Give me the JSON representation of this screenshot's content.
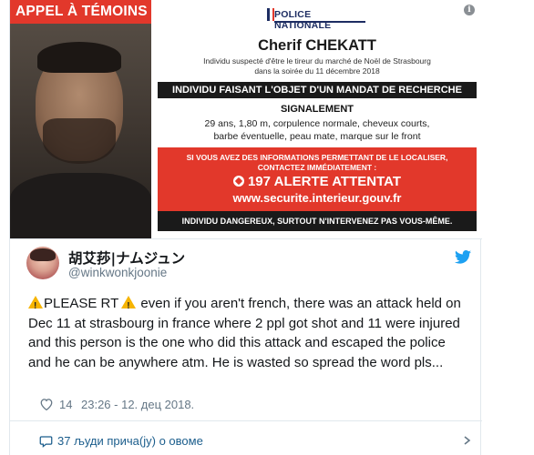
{
  "poster": {
    "appel": "APPEL À TÉMOINS",
    "logo_text": "POLICE NATIONALE",
    "info_symbol": "i",
    "name": "Cherif CHEKATT",
    "sub_line1": "Individu suspecté d'être le tireur du marché de Noël de Strasbourg",
    "sub_line2": "dans la soirée du 11 décembre 2018",
    "mandat": "INDIVIDU FAISANT L'OBJET D'UN MANDAT DE RECHERCHE",
    "signalement_title": "SIGNALEMENT",
    "signalement_line1": "29 ans, 1,80 m, corpulence normale, cheveux courts,",
    "signalement_line2": "barbe éventuelle, peau mate, marque sur le front",
    "red_line1": "SI VOUS AVEZ DES INFORMATIONS PERMETTANT DE LE LOCALISER,",
    "red_line2": "CONTACTEZ IMMÉDIATEMENT :",
    "alert": "197 ALERTE ATTENTAT",
    "website": "www.securite.interieur.gouv.fr",
    "danger": "INDIVIDU DANGEREUX, SURTOUT N'INTERVENEZ PAS VOUS-MÊME."
  },
  "tweet": {
    "display_name": "胡艾莏|ナムジュン",
    "handle": "@winkwonkjoonie",
    "text_a": "PLEASE RT",
    "text_b": " even if you aren't french, there was an attack held on Dec 11 at strasbourg in france where 2 ppl got shot and 11 were injured and this person is the one who did this attack and escaped the police and he can be anywhere atm. He is wasted so spread the word pls...",
    "likes": "14",
    "timestamp": "23:26 - 12. дец 2018.",
    "replies": "37 људи прича(ју) о овоме"
  },
  "colors": {
    "poster_red": "#e2382b",
    "twitter_blue": "#1da1f2",
    "muted_text": "#657786",
    "link_text": "#1b5d8c"
  },
  "icons": [
    "info-icon",
    "phone-icon",
    "twitter-bird-icon",
    "warning-icon",
    "heart-icon",
    "reply-bubble-icon",
    "chevron-down-icon"
  ]
}
